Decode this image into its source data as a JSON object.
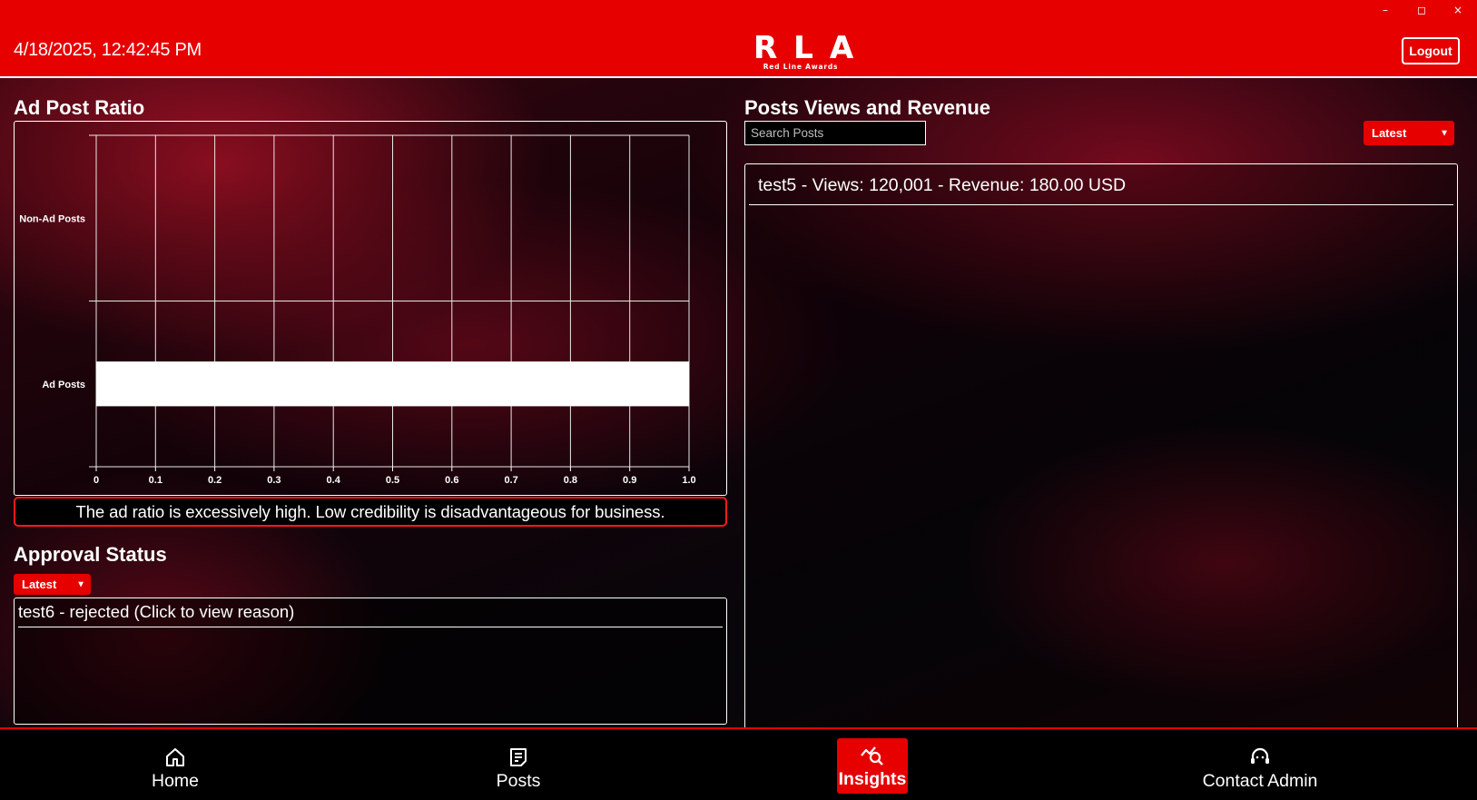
{
  "window": {
    "minimize": "–",
    "maximize": "◻",
    "close": "×"
  },
  "header": {
    "datetime": "4/18/2025, 12:42:45 PM",
    "logo_main": "RLA",
    "logo_sub": "Red Line Awards",
    "logout_label": "Logout"
  },
  "ad_ratio": {
    "title": "Ad Post Ratio",
    "warning": "The ad ratio is excessively high. Low credibility is disadvantageous for business."
  },
  "chart_data": {
    "type": "bar",
    "orientation": "horizontal",
    "categories": [
      "Non-Ad Posts",
      "Ad Posts"
    ],
    "values": [
      0,
      1.0
    ],
    "xlim": [
      0,
      1.0
    ],
    "xticks": [
      "0",
      "0.1",
      "0.2",
      "0.3",
      "0.4",
      "0.5",
      "0.6",
      "0.7",
      "0.8",
      "0.9",
      "1.0"
    ],
    "grid": true,
    "bar_color": "#ffffff",
    "title": "",
    "xlabel": "",
    "ylabel": ""
  },
  "approval": {
    "title": "Approval Status",
    "sort_selected": "Latest",
    "items": [
      {
        "text": "test6 - rejected (Click to view reason)"
      }
    ]
  },
  "posts": {
    "title": "Posts Views and Revenue",
    "search_placeholder": "Search Posts",
    "sort_selected": "Latest",
    "items": [
      {
        "text": "test5 - Views: 120,001 - Revenue: 180.00 USD"
      }
    ]
  },
  "nav": {
    "items": [
      {
        "label": "Home",
        "icon": "home-icon"
      },
      {
        "label": "Posts",
        "icon": "posts-icon"
      },
      {
        "label": "Insights",
        "icon": "insights-icon",
        "active": true
      },
      {
        "label": "Contact Admin",
        "icon": "support-icon"
      }
    ]
  },
  "colors": {
    "accent": "#e60000",
    "background": "#0a0508"
  }
}
